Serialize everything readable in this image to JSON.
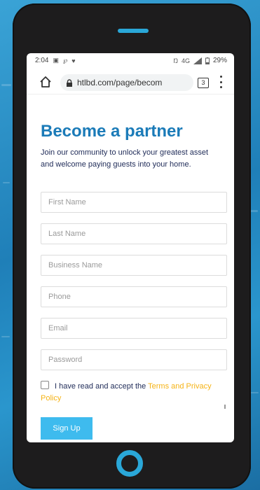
{
  "status_bar": {
    "time": "2:04",
    "battery": "29%",
    "network": "4G"
  },
  "browser": {
    "url": "htlbd.com/page/becom",
    "tabs_count": "3"
  },
  "form": {
    "title": "Become a partner",
    "subtitle": "Join our community to unlock your greatest asset and welcome paying guests into your home.",
    "fields": {
      "first_name": "First Name",
      "last_name": "Last Name",
      "business_name": "Business Name",
      "phone": "Phone",
      "email": "Email",
      "password": "Password"
    },
    "agree_text": "I have read and accept the",
    "terms_link": "Terms and Privacy Policy",
    "submit_label": "Sign Up"
  },
  "colors": {
    "accent": "#1b7bb8",
    "button": "#3ebbee",
    "link": "#f5b316",
    "phone_frame": "#1d1c1d",
    "background": "#2a96cd"
  }
}
